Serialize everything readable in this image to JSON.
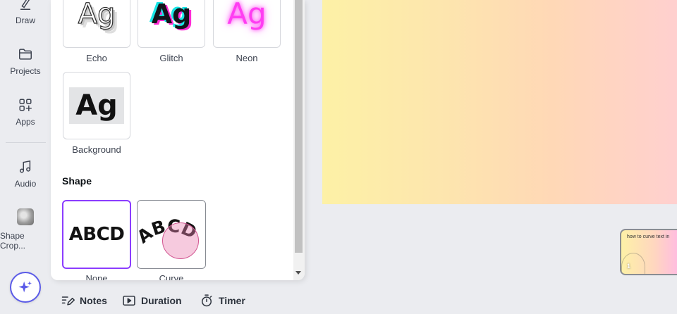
{
  "sidebar": {
    "items": [
      {
        "label": "Draw",
        "icon": "draw-icon"
      },
      {
        "label": "Projects",
        "icon": "folder-icon"
      },
      {
        "label": "Apps",
        "icon": "apps-icon"
      },
      {
        "label": "Audio",
        "icon": "music-note-icon"
      },
      {
        "label": "Shape Crop...",
        "icon": "shape-crop-app-icon"
      }
    ],
    "magic_button_icon": "sparkle-icon"
  },
  "effects_panel": {
    "style_effects": [
      {
        "label": "Echo",
        "preview": "Ag"
      },
      {
        "label": "Glitch",
        "preview": "Ag"
      },
      {
        "label": "Neon",
        "preview": "Ag"
      },
      {
        "label": "Background",
        "preview": "Ag"
      }
    ],
    "shape_section_title": "Shape",
    "shape_options": [
      {
        "label": "None",
        "preview": "ABCD",
        "selected": true
      },
      {
        "label": "Curve",
        "preview": "ABCD",
        "selected": false
      }
    ]
  },
  "footer": {
    "notes_label": "Notes",
    "duration_label": "Duration",
    "timer_label": "Timer"
  },
  "page_thumbnail": {
    "title": "how to curve text in",
    "page_number": "1"
  },
  "colors": {
    "accent_purple": "#8b3dff",
    "magic_blue": "#5b5be8",
    "neon_pink": "#ff3df2",
    "curve_circle_pink": "#e980b0"
  }
}
